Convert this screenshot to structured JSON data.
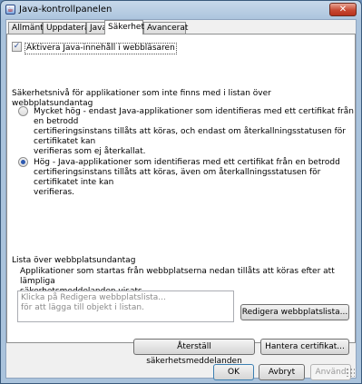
{
  "window": {
    "title": "Java-kontrollpanelen",
    "close_glyph": "✕"
  },
  "tabs": [
    {
      "label": "Allmänt"
    },
    {
      "label": "Uppdatera"
    },
    {
      "label": "Java"
    },
    {
      "label": "Säkerhet",
      "active": true
    },
    {
      "label": "Avancerat"
    }
  ],
  "security": {
    "enable_browser": {
      "label": "Aktivera Java-innehåll i webbläsaren",
      "checked": true
    },
    "level_heading": "Säkerhetsnivå för applikationer som inte finns med i listan över webbplatsundantag",
    "levels": [
      {
        "selected": false,
        "lines": [
          "Mycket hög - endast Java-applikationer som identifieras med ett certifikat från en betrodd",
          "certifieringsinstans tillåts att köras, och endast om återkallningsstatusen för certifikatet kan",
          "verifieras som ej återkallat."
        ]
      },
      {
        "selected": true,
        "lines": [
          "Hög - Java-applikationer som identifieras med ett certifikat från en betrodd",
          "certifieringsinstans tillåts att köras, även om återkallningsstatusen för certifikatet inte kan",
          "verifieras."
        ]
      }
    ],
    "exception_list": {
      "heading": "Lista över webbplatsundantag",
      "description_lines": [
        "Applikationer som startas från webbplatserna nedan tillåts att köras efter att lämpliga",
        "säkerhetsmeddelanden visats."
      ],
      "placeholder_lines": [
        "Klicka på Redigera webbplatslista...",
        "för att lägga till objekt i listan."
      ],
      "edit_button": "Redigera webbplatslista..."
    },
    "restore_button": "Återställ säkerhetsmeddelanden",
    "manage_certs_button": "Hantera certifikat..."
  },
  "footer": {
    "ok": "OK",
    "cancel": "Avbryt",
    "apply": "Använd",
    "apply_enabled": false
  },
  "colors": {
    "titlebar": "#aac3dc",
    "panel": "#ffffff",
    "dialog": "#f0f0f0",
    "accent": "#2e5ab0"
  }
}
